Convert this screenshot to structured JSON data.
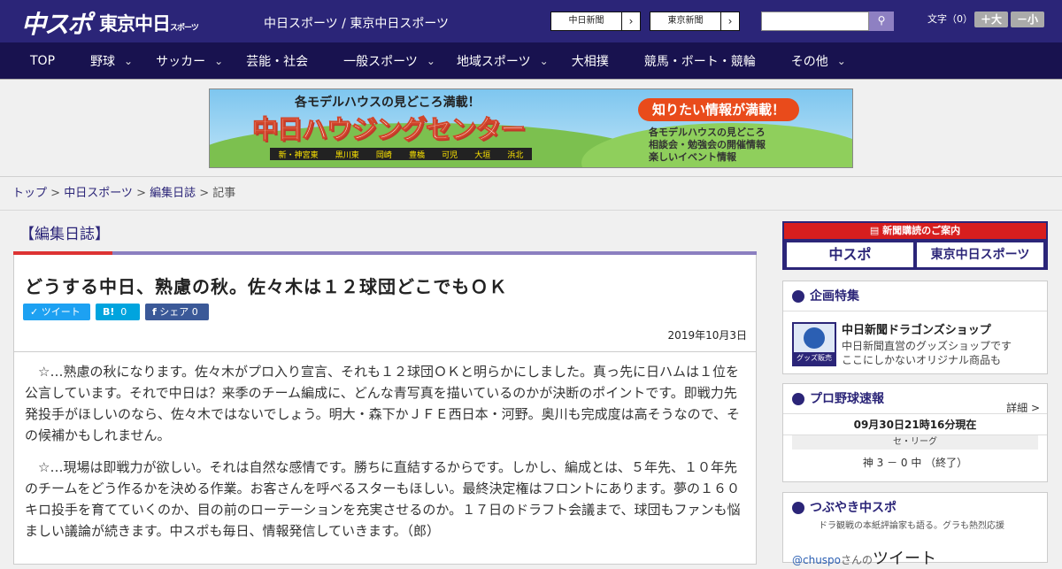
{
  "header": {
    "logo_chunichi_sports": "中スポ",
    "logo_tokyo": "東京中日",
    "logo_tokyo_small": "スポーツ",
    "site_names": "中日スポーツ / 東京中日スポーツ",
    "paper_buttons": [
      "中日新聞",
      "東京新聞"
    ],
    "search_placeholder": "",
    "font_size_label": "文字（0）",
    "font_bigger": "＋大",
    "font_smaller": "－小"
  },
  "nav": {
    "items": [
      {
        "label": "TOP",
        "has_menu": false
      },
      {
        "label": "野球",
        "has_menu": true
      },
      {
        "label": "サッカー",
        "has_menu": true
      },
      {
        "label": "芸能・社会",
        "has_menu": false
      },
      {
        "label": "一般スポーツ",
        "has_menu": true
      },
      {
        "label": "地域スポーツ",
        "has_menu": true
      },
      {
        "label": "大相撲",
        "has_menu": false
      },
      {
        "label": "競馬・ボート・競輪",
        "has_menu": false
      },
      {
        "label": "その他",
        "has_menu": true
      }
    ]
  },
  "banner": {
    "tagline": "各モデルハウスの見どころ満載！",
    "title": "中日ハウジングセンター",
    "areas": [
      "新・神宮東",
      "黒川東",
      "岡崎",
      "豊橋",
      "可児",
      "大垣",
      "浜北"
    ],
    "headline": "知りたい情報が満載！",
    "features": [
      "各モデルハウスの見どころ",
      "相談会・勉強会の開催情報",
      "楽しいイベント情報"
    ]
  },
  "breadcrumb": {
    "items": [
      "トップ",
      "中日スポーツ",
      "編集日誌"
    ],
    "current": "記事",
    "separator": " > "
  },
  "article": {
    "category": "【編集日誌】",
    "title": "どうする中日、熟慮の秋。佐々木は１２球団どこでもＯＫ",
    "share": {
      "tweet": "ツイート",
      "hatena": "B!",
      "hatena_count": "0",
      "facebook": "シェア",
      "facebook_count": "0"
    },
    "date": "2019年10月3日",
    "paragraphs": [
      "☆…熟慮の秋になります。佐々木がプロ入り宣言、それも１２球団ＯＫと明らかにしました。真っ先に日ハムは１位を公言しています。それで中日は？来季のチーム編成に、どんな青写真を描いているのかが決断のポイントです。即戦力先発投手がほしいのなら、佐々木ではないでしょう。明大・森下かＪＦＥ西日本・河野。奥川も完成度は高そうなので、その候補かもしれません。",
      "☆…現場は即戦力が欲しい。それは自然な感情です。勝ちに直結するからです。しかし、編成とは、５年先、１０年先のチームをどう作るかを決める作業。お客さんを呼べるスターもほしい。最終決定権はフロントにあります。夢の１６０キロ投手を育てていくのか、目の前のローテーションを充実させるのか。１７日のドラフト会議まで、球団もファンも悩ましい議論が続きます。中スポも毎日、情報発信していきます。（郎）"
    ]
  },
  "sidebar": {
    "subscribe": {
      "header": "新聞購読のご案内",
      "left": "中スポ",
      "right": "東京中日スポーツ"
    },
    "special": {
      "title": "企画特集",
      "shop_name": "中日新聞ドラゴンズショップ",
      "shop_desc_1": "中日新聞直営のグッズショップです",
      "shop_desc_2": "ここにしかないオリジナル商品も",
      "thumb_label": "グッズ販売中"
    },
    "baseball": {
      "title": "プロ野球速報",
      "more": "詳細 >",
      "updated": "09月30日21時16分現在",
      "league": "セ・リーグ",
      "score": "神 3 － 0 中 （終了）"
    },
    "tweets": {
      "title": "つぶやき中スポ",
      "subtitle": "ドラ観戦の本紙評論家も語る。グラも熱烈応援",
      "user": "@chuspo",
      "user_suffix": "さんの",
      "label": "ツイート"
    }
  },
  "colors": {
    "header_bg": "#2b2578",
    "nav_bg": "#18124f",
    "accent_red": "#d33",
    "twitter": "#1da1f2",
    "hatena": "#00a4de",
    "facebook": "#3b5998"
  }
}
